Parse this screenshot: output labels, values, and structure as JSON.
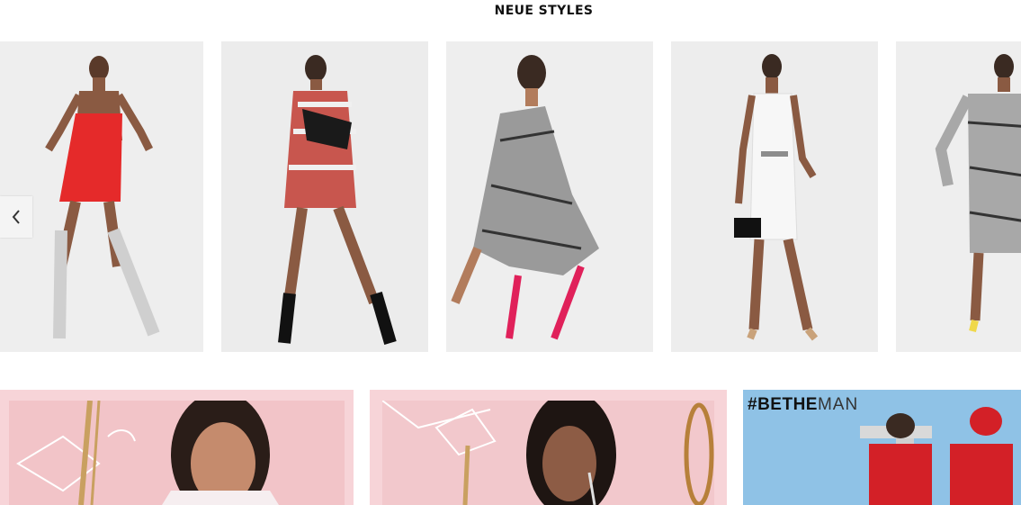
{
  "section": {
    "title": "NEUE STYLES"
  },
  "carousel": {
    "prev_icon": "chevron-left-icon",
    "products": [
      {
        "description": "red slip dress with snake print boots",
        "dress_color": "#e52a2a",
        "shoe_color": "#cfcfcf"
      },
      {
        "description": "snake print t-shirt dress with bum bag",
        "dress_color": "#c8564e",
        "shoe_color": "#111111"
      },
      {
        "description": "snake print bodycon dress with pink heels",
        "dress_color": "#9a9a9a",
        "shoe_color": "#e0215a"
      },
      {
        "description": "white midi dress with belt",
        "dress_color": "#f5f5f5",
        "shoe_color": "#c9a27a"
      },
      {
        "description": "snake print off-shoulder midi dress",
        "dress_color": "#a8a8a8",
        "shoe_color": "#f0d84a"
      }
    ]
  },
  "banners": [
    {
      "label": "valentine campaign banner 1",
      "bg": "#f7d4d8"
    },
    {
      "label": "valentine campaign banner 2",
      "bg": "#f7d4d8"
    },
    {
      "hashtag_bold": "#BETHE",
      "hashtag_light": "MAN",
      "bg": "#e0eef8"
    }
  ]
}
